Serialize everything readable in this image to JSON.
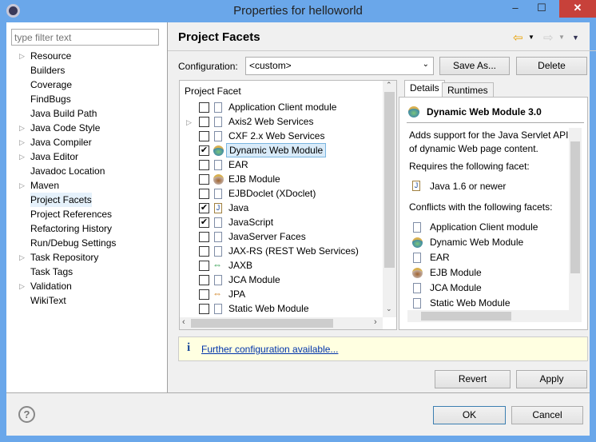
{
  "window": {
    "title": "Properties for helloworld",
    "minimize": "–",
    "maximize": "☐",
    "close": "✕"
  },
  "sidebar": {
    "filter_placeholder": "type filter text",
    "items": [
      {
        "label": "Resource",
        "expandable": true
      },
      {
        "label": "Builders"
      },
      {
        "label": "Coverage"
      },
      {
        "label": "FindBugs"
      },
      {
        "label": "Java Build Path"
      },
      {
        "label": "Java Code Style",
        "expandable": true
      },
      {
        "label": "Java Compiler",
        "expandable": true
      },
      {
        "label": "Java Editor",
        "expandable": true
      },
      {
        "label": "Javadoc Location"
      },
      {
        "label": "Maven",
        "expandable": true
      },
      {
        "label": "Project Facets",
        "selected": true
      },
      {
        "label": "Project References"
      },
      {
        "label": "Refactoring History"
      },
      {
        "label": "Run/Debug Settings"
      },
      {
        "label": "Task Repository",
        "expandable": true
      },
      {
        "label": "Task Tags"
      },
      {
        "label": "Validation",
        "expandable": true
      },
      {
        "label": "WikiText"
      }
    ]
  },
  "main": {
    "title": "Project Facets",
    "configuration": {
      "label": "Configuration:",
      "value": "<custom>",
      "save_as": "Save As...",
      "delete": "Delete"
    },
    "facets": {
      "header": "Project Facet",
      "items": [
        {
          "label": "Application Client module",
          "checked": false,
          "icon": "document-icon"
        },
        {
          "label": "Axis2 Web Services",
          "checked": false,
          "icon": "document-icon",
          "expandable": true
        },
        {
          "label": "CXF 2.x Web Services",
          "checked": false,
          "icon": "document-icon"
        },
        {
          "label": "Dynamic Web Module",
          "checked": true,
          "icon": "globe-jar-icon",
          "selected": true
        },
        {
          "label": "EAR",
          "checked": false,
          "icon": "document-icon"
        },
        {
          "label": "EJB Module",
          "checked": false,
          "icon": "bean-jar-icon"
        },
        {
          "label": "EJBDoclet (XDoclet)",
          "checked": false,
          "icon": "document-icon"
        },
        {
          "label": "Java",
          "checked": true,
          "icon": "java-icon"
        },
        {
          "label": "JavaScript",
          "checked": true,
          "icon": "document-icon"
        },
        {
          "label": "JavaServer Faces",
          "checked": false,
          "icon": "document-icon"
        },
        {
          "label": "JAX-RS (REST Web Services)",
          "checked": false,
          "icon": "document-icon"
        },
        {
          "label": "JAXB",
          "checked": false,
          "icon": "arrows-green-icon"
        },
        {
          "label": "JCA Module",
          "checked": false,
          "icon": "document-icon"
        },
        {
          "label": "JPA",
          "checked": false,
          "icon": "arrows-orange-icon"
        },
        {
          "label": "Static Web Module",
          "checked": false,
          "icon": "document-icon"
        }
      ]
    },
    "details": {
      "tabs": [
        "Details",
        "Runtimes"
      ],
      "active_tab": "Details",
      "title": "Dynamic Web Module 3.0",
      "description": [
        "Adds support for the Java Servlet API,",
        "of dynamic Web page content."
      ],
      "requires_label": "Requires the following facet:",
      "requires": [
        "Java 1.6 or newer"
      ],
      "conflicts_label": "Conflicts with the following facets:",
      "conflicts": [
        "Application Client module",
        "Dynamic Web Module",
        "EAR",
        "EJB Module",
        "JCA Module",
        "Static Web Module"
      ]
    },
    "info": {
      "icon": "i",
      "link": "Further configuration available..."
    },
    "revert": "Revert",
    "apply": "Apply"
  },
  "footer": {
    "help": "?",
    "ok": "OK",
    "cancel": "Cancel"
  }
}
